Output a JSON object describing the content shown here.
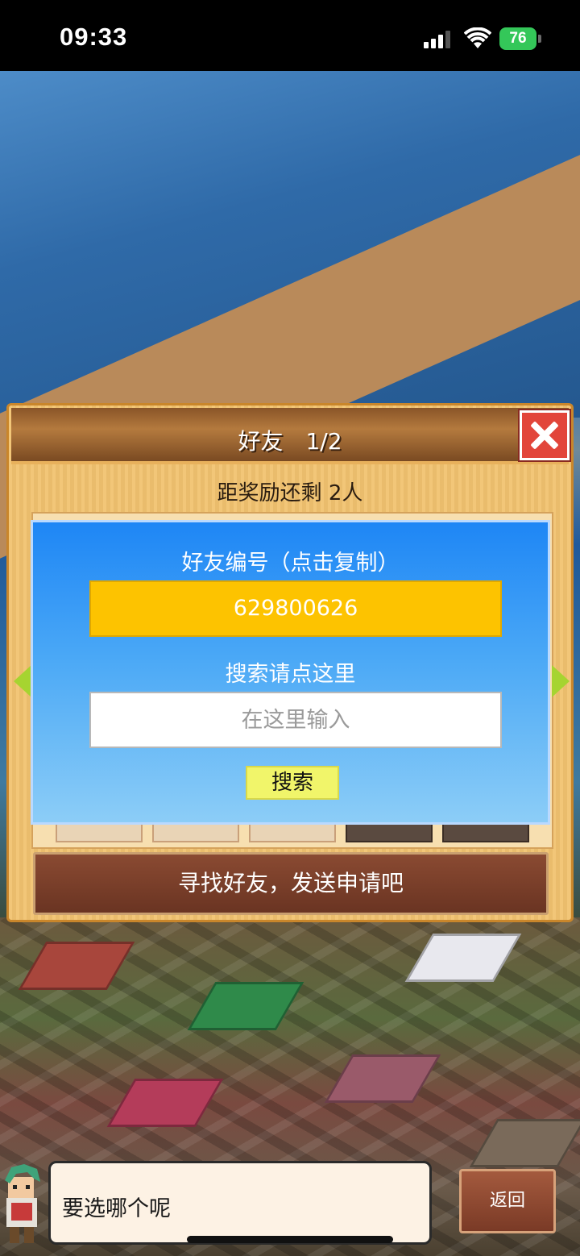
{
  "status_bar": {
    "time": "09:33",
    "battery": "76"
  },
  "panel": {
    "title": "好友　1/2",
    "reward_text": "距奖励还剩 2人",
    "send_request_label": "寻找好友，发送申请吧"
  },
  "popup": {
    "heading": "好友编号（点击复制）",
    "friend_id": "629800626",
    "search_heading": "搜索请点这里",
    "search_placeholder": "在这里输入",
    "search_value": "",
    "search_button": "搜索"
  },
  "dialogue": {
    "text": "要选哪个呢"
  },
  "back_button": "返回",
  "colors": {
    "popup_top": "#1e86f5",
    "friend_id_bg": "#fdc300",
    "search_button_bg": "#f1f56a",
    "close_button": "#e2453a"
  },
  "icons": [
    "signal-icon",
    "wifi-icon",
    "battery-icon",
    "close-icon",
    "arrow-left-icon",
    "arrow-right-icon"
  ]
}
